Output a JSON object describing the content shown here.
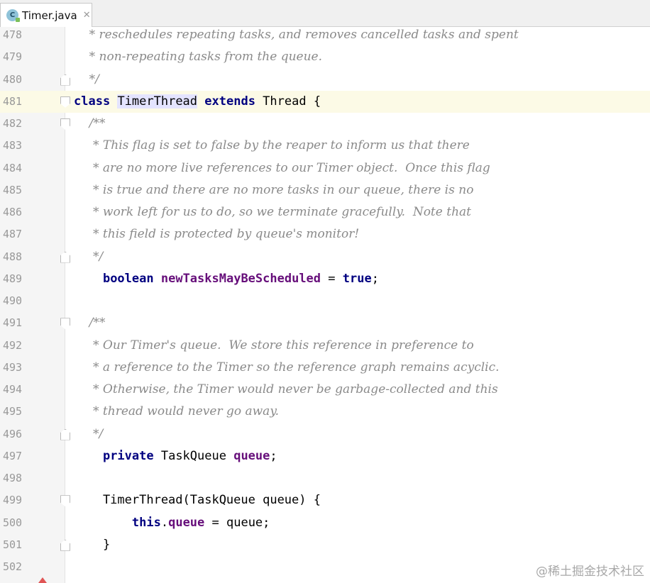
{
  "tab": {
    "icon_letter": "C",
    "filename": "Timer.java",
    "close_glyph": "✕"
  },
  "watermark": "@稀土掘金技术社区",
  "lines": [
    {
      "n": "478",
      "doc": "    * reschedules repeating tasks, and removes cancelled tasks and spent"
    },
    {
      "n": "479",
      "doc": "    * non-repeating tasks from the queue."
    },
    {
      "n": "480",
      "doc": "    */",
      "fold": "close"
    },
    {
      "n": "481",
      "fold": "open",
      "current": true
    },
    {
      "n": "482",
      "doc": "    /**",
      "fold": "open"
    },
    {
      "n": "483",
      "doc": "     * This flag is set to false by the reaper to inform us that there"
    },
    {
      "n": "484",
      "doc": "     * are no more live references to our Timer object.  Once this flag"
    },
    {
      "n": "485",
      "doc": "     * is true and there are no more tasks in our queue, there is no"
    },
    {
      "n": "486",
      "doc": "     * work left for us to do, so we terminate gracefully.  Note that"
    },
    {
      "n": "487",
      "doc": "     * this field is protected by queue's monitor!"
    },
    {
      "n": "488",
      "doc": "     */",
      "fold": "close"
    },
    {
      "n": "489"
    },
    {
      "n": "490"
    },
    {
      "n": "491",
      "doc": "    /**",
      "fold": "open"
    },
    {
      "n": "492",
      "doc": "     * Our Timer's queue.  We store this reference in preference to"
    },
    {
      "n": "493",
      "doc": "     * a reference to the Timer so the reference graph remains acyclic."
    },
    {
      "n": "494",
      "doc": "     * Otherwise, the Timer would never be garbage-collected and this"
    },
    {
      "n": "495",
      "doc": "     * thread would never go away."
    },
    {
      "n": "496",
      "doc": "     */",
      "fold": "close"
    },
    {
      "n": "497"
    },
    {
      "n": "498"
    },
    {
      "n": "499",
      "fold": "open"
    },
    {
      "n": "500"
    },
    {
      "n": "501",
      "fold": "close"
    },
    {
      "n": "502"
    }
  ],
  "code": {
    "l481": {
      "kw_class": "class",
      "name": "TimerThread",
      "kw_extends": "extends",
      "rest": " Thread {"
    },
    "l489": {
      "indent": "    ",
      "kw": "boolean",
      "field": "newTasksMayBeScheduled",
      "eq": " = ",
      "val": "true",
      "end": ";"
    },
    "l497": {
      "indent": "    ",
      "kw": "private",
      "type": " TaskQueue ",
      "field": "queue",
      "end": ";"
    },
    "l499": {
      "text": "    TimerThread(TaskQueue queue) {"
    },
    "l500": {
      "indent": "        ",
      "kw": "this",
      "dot": ".",
      "field": "queue",
      "rest": " = queue;"
    },
    "l501": {
      "text": "    }"
    }
  }
}
